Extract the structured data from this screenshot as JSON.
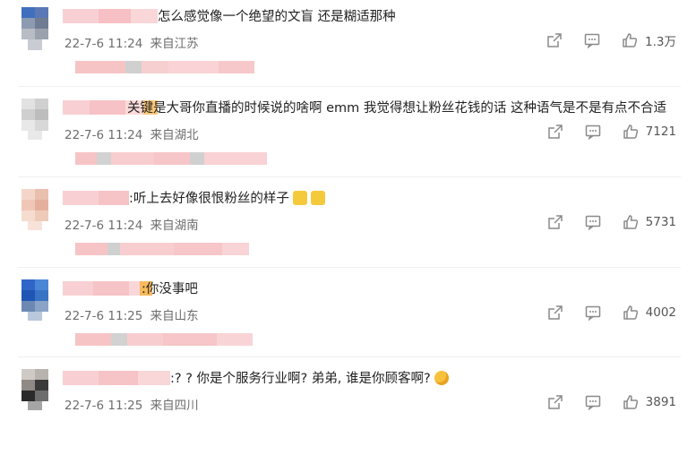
{
  "comments": [
    {
      "text": "怎么感觉像一个绝望的文盲 还是糊适那种",
      "time": "22-7-6 11:24",
      "location": "来自江苏",
      "likes": "1.3万",
      "emojis": []
    },
    {
      "text": "关键是大哥你直播的时候说的啥啊 emm 我觉得想让粉丝花钱的话 这种语气是不是有点不合适",
      "time": "22-7-6 11:24",
      "location": "来自湖北",
      "likes": "7121",
      "emojis": []
    },
    {
      "text": ":听上去好像很恨粉丝的样子",
      "time": "22-7-6 11:24",
      "location": "来自湖南",
      "likes": "5731",
      "emojis": [
        "square-face-emoji",
        "square-face-emoji"
      ]
    },
    {
      "text": ":你没事吧",
      "time": "22-7-6 11:25",
      "location": "来自山东",
      "likes": "4002",
      "emojis": []
    },
    {
      "text": ":? ? 你是个服务行业啊? 弟弟, 谁是你顾客啊?",
      "time": "22-7-6 11:25",
      "location": "来自四川",
      "likes": "3891",
      "emojis": [
        "thinking-emoji"
      ]
    }
  ],
  "colors": {
    "blur_pink": "#f7c4c6",
    "blur_peach": "#f6d3c2",
    "blur_grey": "#d4d4d4",
    "icon": "#8a8a8a"
  }
}
